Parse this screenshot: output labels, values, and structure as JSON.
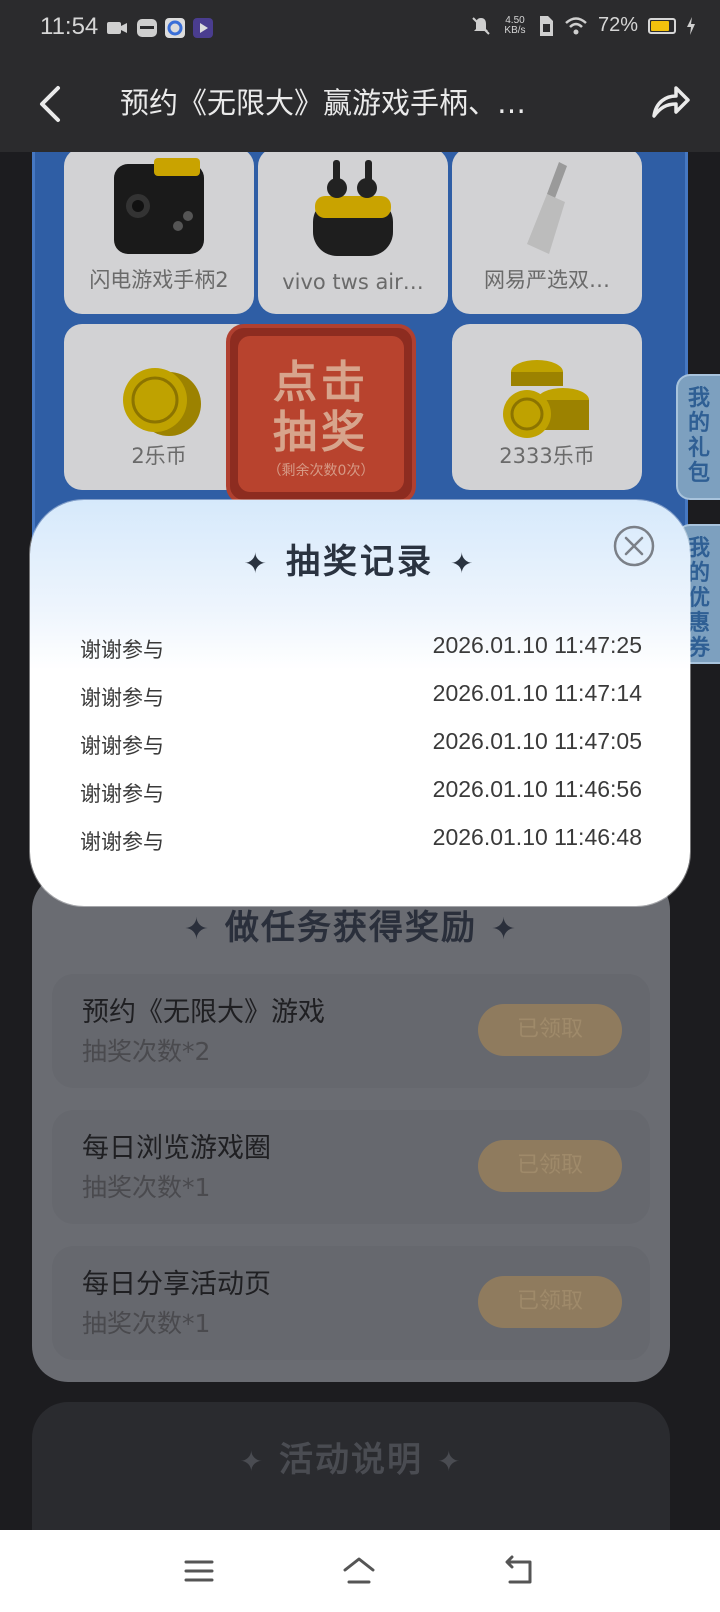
{
  "status_bar": {
    "time": "11:54",
    "net_speed": "4.50 KB/s",
    "battery_percent": "72%"
  },
  "nav": {
    "title": "预约《无限大》赢游戏手柄、…"
  },
  "prizes": [
    {
      "label": "闪电游戏手柄2",
      "icon": "gamepad-icon"
    },
    {
      "label": "vivo tws air…",
      "icon": "earbuds-icon"
    },
    {
      "label": "网易严选双…",
      "icon": "knife-icon"
    },
    {
      "label": "2乐币",
      "icon": "coin-icon"
    },
    {
      "label": "2333乐币",
      "icon": "coin-stack-icon"
    }
  ],
  "draw_button": {
    "line1": "点击",
    "line2": "抽奖",
    "remaining": "（剩余次数0次）"
  },
  "side_tabs": {
    "gifts": "我的礼包",
    "coupons": "我的优惠券"
  },
  "tasks": {
    "heading": "做任务获得奖励",
    "items": [
      {
        "name": "预约《无限大》游戏",
        "reward": "抽奖次数*2",
        "status": "已领取"
      },
      {
        "name": "每日浏览游戏圈",
        "reward": "抽奖次数*1",
        "status": "已领取"
      },
      {
        "name": "每日分享活动页",
        "reward": "抽奖次数*1",
        "status": "已领取"
      }
    ]
  },
  "rules": {
    "heading": "活动说明"
  },
  "modal": {
    "title": "抽奖记录",
    "records": [
      {
        "result": "谢谢参与",
        "time": "2026.01.10 11:47:25"
      },
      {
        "result": "谢谢参与",
        "time": "2026.01.10 11:47:14"
      },
      {
        "result": "谢谢参与",
        "time": "2026.01.10 11:47:05"
      },
      {
        "result": "谢谢参与",
        "time": "2026.01.10 11:46:56"
      },
      {
        "result": "谢谢参与",
        "time": "2026.01.10 11:46:48"
      }
    ]
  },
  "colors": {
    "accent_battery": "#f2c10d",
    "modal_gradient_top": "#d6e9fb",
    "prize_frame": "#2f5ea5"
  }
}
